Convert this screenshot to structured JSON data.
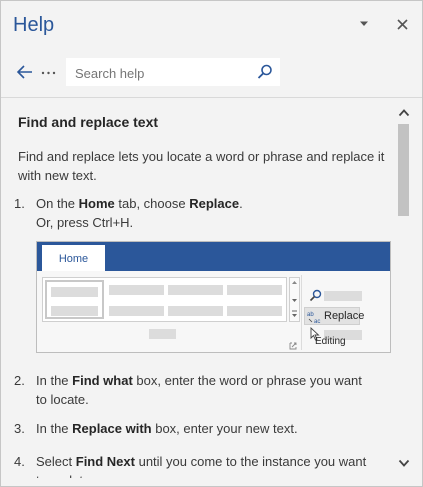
{
  "header": {
    "title": "Help",
    "dropdown_icon": "chevron-down-icon",
    "close_icon": "close-icon"
  },
  "nav": {
    "back_icon": "back-arrow-icon",
    "more_icon": "more-icon",
    "search": {
      "placeholder": "Search help",
      "value": "",
      "icon": "search-icon"
    }
  },
  "article": {
    "heading": "Find and replace text",
    "intro": "Find and replace lets you locate a word or phrase and replace it with new text.",
    "steps": [
      {
        "num": "1.",
        "parts": [
          "On the ",
          "Home",
          " tab, choose ",
          "Replace",
          "."
        ],
        "line2": "Or, press Ctrl+H."
      },
      {
        "num": "2.",
        "parts": [
          "In the ",
          "Find what",
          " box, enter the word or phrase you want to locate."
        ]
      },
      {
        "num": "3.",
        "parts": [
          "In the ",
          "Replace with",
          " box, enter your new text."
        ]
      },
      {
        "num": "4.",
        "parts": [
          "Select ",
          "Find Next",
          " until you come to the instance you want to update."
        ]
      }
    ],
    "figure": {
      "tab_label": "Home",
      "replace_label": "Replace",
      "replace_icon_text": "ab→ac",
      "group_label": "Editing"
    }
  },
  "colors": {
    "accent": "#2b579a",
    "background": "#f3f3f3",
    "text": "#262626"
  }
}
